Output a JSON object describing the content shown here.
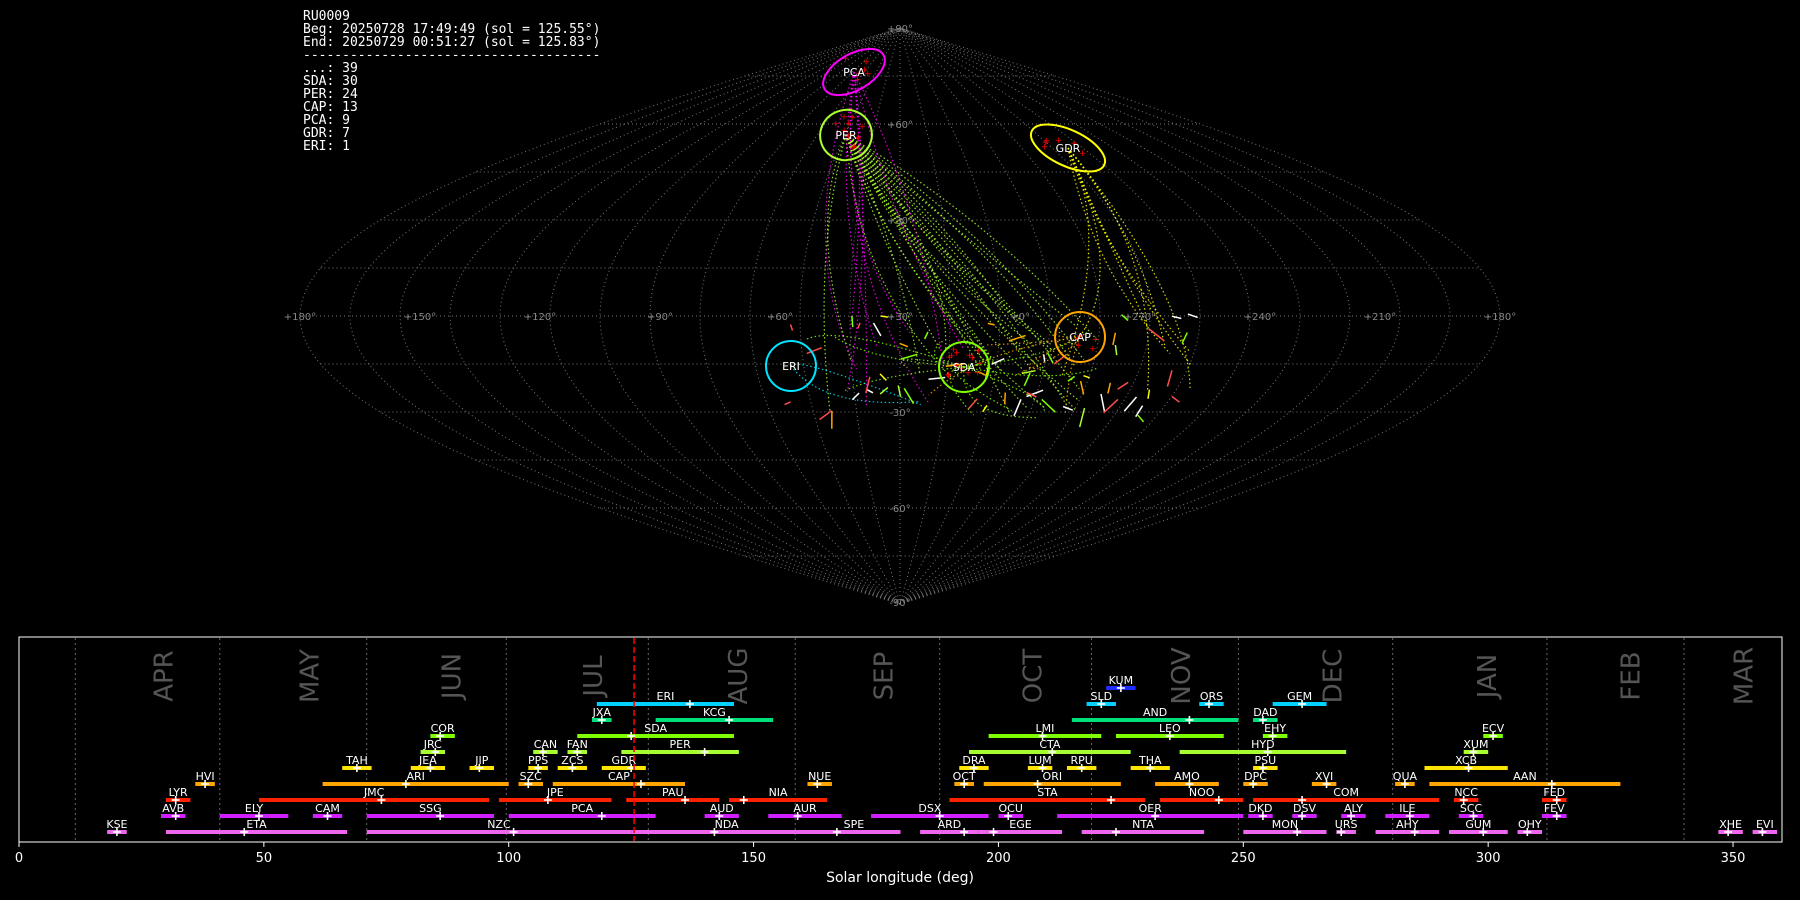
{
  "header": {
    "station": "RU0009",
    "beg": "Beg: 20250728 17:49:49 (sol = 125.55°)",
    "end": "End: 20250729 00:51:27 (sol = 125.83°)",
    "divider": "--------------------------------------",
    "counts": [
      "...: 39",
      "SDA: 30",
      "PER: 24",
      "CAP: 13",
      "PCA: 9",
      "GDR: 7",
      "ERI: 1"
    ]
  },
  "colors": {
    "SDA": "#7fff00",
    "PER": "#adff2f",
    "CAP": "#ffa500",
    "PCA": "#ff00ff",
    "GDR": "#ffff00",
    "ERI": "#00e5ff",
    "sporadic": "#ff4d4d",
    "grid": "#777777",
    "marker": "#ff0000"
  },
  "sky_plot": {
    "lon_labels": [
      "+180°",
      "+150°",
      "+120°",
      "+90°",
      "+60°",
      "+30°",
      "+0°",
      "+270°",
      "+240°",
      "+210°",
      "+180°"
    ],
    "lat_labels": [
      "+90°",
      "+60°",
      "+30°",
      "-30°",
      "-60°",
      "-90°"
    ],
    "radiants": [
      {
        "name": "PCA",
        "color": "PCA"
      },
      {
        "name": "PER",
        "color": "PER"
      },
      {
        "name": "GDR",
        "color": "GDR"
      },
      {
        "name": "CAP",
        "color": "CAP"
      },
      {
        "name": "SDA",
        "color": "SDA"
      },
      {
        "name": "ERI",
        "color": "ERI"
      }
    ]
  },
  "chart_data": {
    "type": "timeline",
    "xlabel": "Solar longitude (deg)",
    "xlim": [
      0,
      360
    ],
    "xticks": [
      0,
      50,
      100,
      150,
      200,
      250,
      300,
      350
    ],
    "current_sol": 125.6,
    "months": [
      {
        "name": "APR",
        "start": 11.5
      },
      {
        "name": "MAY",
        "start": 41
      },
      {
        "name": "JUN",
        "start": 71
      },
      {
        "name": "JUL",
        "start": 99.5
      },
      {
        "name": "AUG",
        "start": 128.5
      },
      {
        "name": "SEP",
        "start": 158.5
      },
      {
        "name": "OCT",
        "start": 188
      },
      {
        "name": "NOV",
        "start": 219
      },
      {
        "name": "DEC",
        "start": 249
      },
      {
        "name": "JAN",
        "start": 280.5
      },
      {
        "name": "FEB",
        "start": 312
      },
      {
        "name": "MAR",
        "start": 340
      }
    ],
    "showers": [
      {
        "code": "KUM",
        "start": 222,
        "end": 228,
        "peak": 225,
        "row": 8,
        "color": "#1f2eff"
      },
      {
        "code": "ERI",
        "start": 118,
        "end": 146,
        "peak": 137,
        "row": 7,
        "color": "#00d0ff"
      },
      {
        "code": "SLD",
        "start": 218,
        "end": 224,
        "peak": 221,
        "row": 7,
        "color": "#00d0ff"
      },
      {
        "code": "ORS",
        "start": 241,
        "end": 246,
        "peak": 243,
        "row": 7,
        "color": "#00d0ff"
      },
      {
        "code": "GEM",
        "start": 256,
        "end": 267,
        "peak": 262,
        "row": 7,
        "color": "#00d0ff"
      },
      {
        "code": "JXA",
        "start": 117,
        "end": 121,
        "peak": 119,
        "row": 6,
        "color": "#00e07a"
      },
      {
        "code": "KCG",
        "start": 130,
        "end": 154,
        "peak": 145,
        "row": 6,
        "color": "#00e07a"
      },
      {
        "code": "AND",
        "start": 215,
        "end": 249,
        "peak": 239,
        "row": 6,
        "color": "#00e07a"
      },
      {
        "code": "DAD",
        "start": 252,
        "end": 257,
        "peak": 254,
        "row": 6,
        "color": "#00e07a"
      },
      {
        "code": "COR",
        "start": 84,
        "end": 89,
        "peak": 86,
        "row": 5,
        "color": "#7fff00"
      },
      {
        "code": "SDA",
        "start": 114,
        "end": 146,
        "peak": 125,
        "row": 5,
        "color": "#7fff00"
      },
      {
        "code": "LMI",
        "start": 198,
        "end": 221,
        "peak": 209,
        "row": 5,
        "color": "#7fff00"
      },
      {
        "code": "LEO",
        "start": 224,
        "end": 246,
        "peak": 235,
        "row": 5,
        "color": "#7fff00"
      },
      {
        "code": "EHY",
        "start": 254,
        "end": 259,
        "peak": 256,
        "row": 5,
        "color": "#7fff00"
      },
      {
        "code": "ECV",
        "start": 299,
        "end": 303,
        "peak": 301,
        "row": 5,
        "color": "#7fff00"
      },
      {
        "code": "JRC",
        "start": 82,
        "end": 87,
        "peak": 85,
        "row": 4,
        "color": "#a6ff2f"
      },
      {
        "code": "CAN",
        "start": 105,
        "end": 110,
        "peak": 107,
        "row": 4,
        "color": "#a6ff2f"
      },
      {
        "code": "FAN",
        "start": 112,
        "end": 116,
        "peak": 114,
        "row": 4,
        "color": "#a6ff2f"
      },
      {
        "code": "PER",
        "start": 123,
        "end": 147,
        "peak": 140,
        "row": 4,
        "color": "#a6ff2f"
      },
      {
        "code": "CTA",
        "start": 194,
        "end": 227,
        "peak": 211,
        "row": 4,
        "color": "#a6ff2f"
      },
      {
        "code": "HYD",
        "start": 237,
        "end": 271,
        "peak": 255,
        "row": 4,
        "color": "#a6ff2f"
      },
      {
        "code": "XUM",
        "start": 295,
        "end": 300,
        "peak": 297,
        "row": 4,
        "color": "#a6ff2f"
      },
      {
        "code": "TAH",
        "start": 66,
        "end": 72,
        "peak": 69,
        "row": 3,
        "color": "#ffe500"
      },
      {
        "code": "JEA",
        "start": 80,
        "end": 87,
        "peak": 84,
        "row": 3,
        "color": "#ffe500"
      },
      {
        "code": "JIP",
        "start": 92,
        "end": 97,
        "peak": 94,
        "row": 3,
        "color": "#ffe500"
      },
      {
        "code": "PPS",
        "start": 104,
        "end": 108,
        "peak": 106,
        "row": 3,
        "color": "#ffe500"
      },
      {
        "code": "ZCS",
        "start": 110,
        "end": 116,
        "peak": 113,
        "row": 3,
        "color": "#ffe500"
      },
      {
        "code": "GDR",
        "start": 119,
        "end": 128,
        "peak": 125,
        "row": 3,
        "color": "#ffe500"
      },
      {
        "code": "DRA",
        "start": 192,
        "end": 198,
        "peak": 195,
        "row": 3,
        "color": "#ffe500"
      },
      {
        "code": "LUM",
        "start": 206,
        "end": 211,
        "peak": 209,
        "row": 3,
        "color": "#ffe500"
      },
      {
        "code": "RPU",
        "start": 214,
        "end": 220,
        "peak": 217,
        "row": 3,
        "color": "#ffe500"
      },
      {
        "code": "THA",
        "start": 227,
        "end": 235,
        "peak": 231,
        "row": 3,
        "color": "#ffe500"
      },
      {
        "code": "PSU",
        "start": 252,
        "end": 257,
        "peak": 254,
        "row": 3,
        "color": "#ffe500"
      },
      {
        "code": "XCB",
        "start": 287,
        "end": 304,
        "peak": 296,
        "row": 3,
        "color": "#ffe500"
      },
      {
        "code": "HVI",
        "start": 36,
        "end": 40,
        "peak": 38,
        "row": 2,
        "color": "#ffa500"
      },
      {
        "code": "ARI",
        "start": 62,
        "end": 100,
        "peak": 79,
        "row": 2,
        "color": "#ffa500"
      },
      {
        "code": "SZC",
        "start": 102,
        "end": 107,
        "peak": 104,
        "row": 2,
        "color": "#ffa500"
      },
      {
        "code": "CAP",
        "start": 109,
        "end": 136,
        "peak": 127,
        "row": 2,
        "color": "#ffa500"
      },
      {
        "code": "NUE",
        "start": 161,
        "end": 166,
        "peak": 163,
        "row": 2,
        "color": "#ffa500"
      },
      {
        "code": "OCT",
        "start": 191,
        "end": 195,
        "peak": 193,
        "row": 2,
        "color": "#ffa500"
      },
      {
        "code": "ORI",
        "start": 197,
        "end": 225,
        "peak": 208,
        "row": 2,
        "color": "#ffa500"
      },
      {
        "code": "AMO",
        "start": 232,
        "end": 245,
        "peak": 239,
        "row": 2,
        "color": "#ffa500"
      },
      {
        "code": "DPC",
        "start": 250,
        "end": 255,
        "peak": 252,
        "row": 2,
        "color": "#ffa500"
      },
      {
        "code": "XVI",
        "start": 264,
        "end": 269,
        "peak": 267,
        "row": 2,
        "color": "#ffa500"
      },
      {
        "code": "QUA",
        "start": 281,
        "end": 285,
        "peak": 283,
        "row": 2,
        "color": "#ffa500"
      },
      {
        "code": "AAN",
        "start": 288,
        "end": 327,
        "peak": 313,
        "row": 2,
        "color": "#ffa500"
      },
      {
        "code": "LYR",
        "start": 30,
        "end": 35,
        "peak": 32,
        "row": 1,
        "color": "#ff2200"
      },
      {
        "code": "JMC",
        "start": 49,
        "end": 96,
        "peak": 74,
        "row": 1,
        "color": "#ff2200"
      },
      {
        "code": "JPE",
        "start": 98,
        "end": 121,
        "peak": 108,
        "row": 1,
        "color": "#ff2200"
      },
      {
        "code": "PAU",
        "start": 124,
        "end": 143,
        "peak": 136,
        "row": 1,
        "color": "#ff2200"
      },
      {
        "code": "NIA",
        "start": 145,
        "end": 165,
        "peak": 148,
        "row": 1,
        "color": "#ff2200"
      },
      {
        "code": "STA",
        "start": 190,
        "end": 230,
        "peak": 223,
        "row": 1,
        "color": "#ff2200"
      },
      {
        "code": "NOO",
        "start": 233,
        "end": 250,
        "peak": 245,
        "row": 1,
        "color": "#ff2200"
      },
      {
        "code": "COM",
        "start": 252,
        "end": 290,
        "peak": 262,
        "row": 1,
        "color": "#ff2200"
      },
      {
        "code": "NCC",
        "start": 293,
        "end": 298,
        "peak": 295,
        "row": 1,
        "color": "#ff2200"
      },
      {
        "code": "FED",
        "start": 311,
        "end": 316,
        "peak": 314,
        "row": 1,
        "color": "#ff2200"
      },
      {
        "code": "AVB",
        "start": 29,
        "end": 34,
        "peak": 32,
        "row": 0,
        "color": "#d020ff"
      },
      {
        "code": "ELY",
        "start": 41,
        "end": 55,
        "peak": 49,
        "row": 0,
        "color": "#d020ff"
      },
      {
        "code": "CAM",
        "start": 60,
        "end": 66,
        "peak": 63,
        "row": 0,
        "color": "#d020ff"
      },
      {
        "code": "SSG",
        "start": 71,
        "end": 97,
        "peak": 86,
        "row": 0,
        "color": "#d020ff"
      },
      {
        "code": "PCA",
        "start": 100,
        "end": 130,
        "peak": 119,
        "row": 0,
        "color": "#d020ff"
      },
      {
        "code": "AUD",
        "start": 140,
        "end": 147,
        "peak": 143,
        "row": 0,
        "color": "#d020ff"
      },
      {
        "code": "AUR",
        "start": 153,
        "end": 168,
        "peak": 159,
        "row": 0,
        "color": "#d020ff"
      },
      {
        "code": "DSX",
        "start": 174,
        "end": 198,
        "peak": 188,
        "row": 0,
        "color": "#d020ff"
      },
      {
        "code": "OCU",
        "start": 200,
        "end": 205,
        "peak": 202,
        "row": 0,
        "color": "#d020ff"
      },
      {
        "code": "OER",
        "start": 212,
        "end": 250,
        "peak": 232,
        "row": 0,
        "color": "#d020ff"
      },
      {
        "code": "DKD",
        "start": 251,
        "end": 256,
        "peak": 254,
        "row": 0,
        "color": "#d020ff"
      },
      {
        "code": "DSV",
        "start": 260,
        "end": 265,
        "peak": 262,
        "row": 0,
        "color": "#d020ff"
      },
      {
        "code": "ALY",
        "start": 270,
        "end": 275,
        "peak": 272,
        "row": 0,
        "color": "#d020ff"
      },
      {
        "code": "ILE",
        "start": 279,
        "end": 288,
        "peak": 284,
        "row": 0,
        "color": "#d020ff"
      },
      {
        "code": "SCC",
        "start": 294,
        "end": 299,
        "peak": 297,
        "row": 0,
        "color": "#d020ff"
      },
      {
        "code": "FEV",
        "start": 311,
        "end": 316,
        "peak": 314,
        "row": 0,
        "color": "#d020ff"
      },
      {
        "code": "KSE",
        "start": 18,
        "end": 22,
        "peak": 20,
        "row": -1,
        "color": "#ee66ee"
      },
      {
        "code": "ETA",
        "start": 30,
        "end": 67,
        "peak": 46,
        "row": -1,
        "color": "#ee66ee"
      },
      {
        "code": "NZC",
        "start": 71,
        "end": 125,
        "peak": 101,
        "row": -1,
        "color": "#ee66ee"
      },
      {
        "code": "NDA",
        "start": 125,
        "end": 164,
        "peak": 142,
        "row": -1,
        "color": "#ee66ee"
      },
      {
        "code": "SPE",
        "start": 161,
        "end": 180,
        "peak": 167,
        "row": -1,
        "color": "#ee66ee"
      },
      {
        "code": "ARD",
        "start": 184,
        "end": 196,
        "peak": 193,
        "row": -1,
        "color": "#ee66ee"
      },
      {
        "code": "EGE",
        "start": 196,
        "end": 213,
        "peak": 199,
        "row": -1,
        "color": "#ee66ee"
      },
      {
        "code": "NTA",
        "start": 217,
        "end": 242,
        "peak": 224,
        "row": -1,
        "color": "#ee66ee"
      },
      {
        "code": "MON",
        "start": 250,
        "end": 267,
        "peak": 261,
        "row": -1,
        "color": "#ee66ee"
      },
      {
        "code": "URS",
        "start": 269,
        "end": 273,
        "peak": 270,
        "row": -1,
        "color": "#ee66ee"
      },
      {
        "code": "AHY",
        "start": 277,
        "end": 290,
        "peak": 285,
        "row": -1,
        "color": "#ee66ee"
      },
      {
        "code": "GUM",
        "start": 292,
        "end": 304,
        "peak": 299,
        "row": -1,
        "color": "#ee66ee"
      },
      {
        "code": "OHY",
        "start": 306,
        "end": 311,
        "peak": 308,
        "row": -1,
        "color": "#ee66ee"
      },
      {
        "code": "XHE",
        "start": 347,
        "end": 352,
        "peak": 349,
        "row": -1,
        "color": "#ee66ee"
      },
      {
        "code": "EVI",
        "start": 354,
        "end": 359,
        "peak": 356,
        "row": -1,
        "color": "#ee66ee"
      }
    ]
  }
}
